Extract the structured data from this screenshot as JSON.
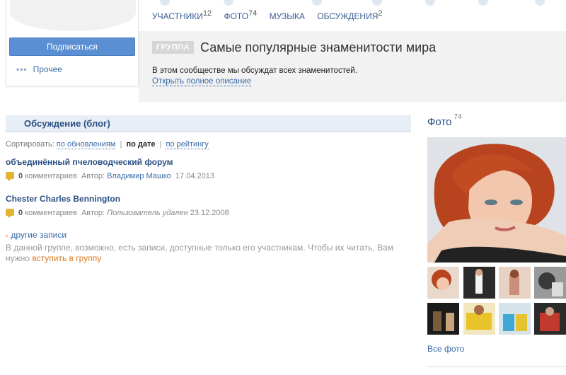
{
  "left": {
    "subscribe_label": "Подписаться",
    "more_label": "Прочее"
  },
  "tabs": [
    {
      "label": "Участники",
      "count": "12"
    },
    {
      "label": "Фото",
      "count": "74"
    },
    {
      "label": "Музыка",
      "count": ""
    },
    {
      "label": "Обсуждения",
      "count": "2"
    }
  ],
  "group": {
    "badge": "ГРУППА",
    "title": "Самые популярные знаменитости мира",
    "description": "В этом сообществе мы обсуждат всех знаменитостей.",
    "open_description": "Открыть полное описание"
  },
  "discussion": {
    "heading": "Обсуждение (блог)",
    "sort_label": "Сортировать:",
    "sort_options": [
      "по обновлениям",
      "по дате",
      "по рейтингу"
    ],
    "posts": [
      {
        "title": "объединённый пчеловодческий форум",
        "comments": "0",
        "comments_label": "комментариев",
        "author_label": "Автор:",
        "author": "Владимир Машко",
        "date": "17.04.2013"
      },
      {
        "title": "Chester Charles Bennington",
        "comments": "0",
        "comments_label": "комментариев",
        "author_label": "Автор:",
        "author": "Пользователь удален",
        "date": "23.12.2008"
      }
    ],
    "other_posts": "другие записи",
    "notice_text": "В данной группе, возможно, есть записи, доступные только его участникам. Чтобы их читать, Вам нужно",
    "join_link": "вступить в группу"
  },
  "photos": {
    "heading": "Фото",
    "count": "74",
    "all_photos": "Все фото"
  },
  "colors": {
    "accent": "#2a4f84",
    "link": "#3a6aa8",
    "button": "#5b8fd4",
    "orange": "#e07a1e"
  }
}
